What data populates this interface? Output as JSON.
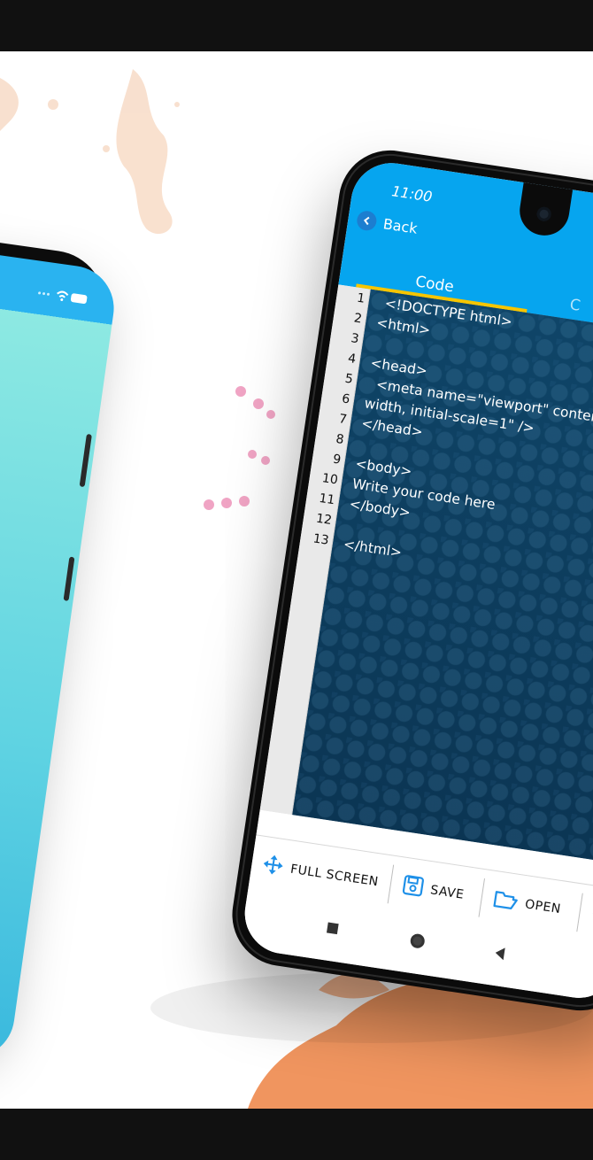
{
  "status": {
    "time": "11:00"
  },
  "header": {
    "back_label": "Back"
  },
  "tabs": [
    {
      "label": "Code",
      "active": true
    },
    {
      "label": "C",
      "active": false
    }
  ],
  "editor": {
    "line_numbers": [
      "1",
      "2",
      "3",
      "4",
      "5",
      "6",
      "7",
      "8",
      "9",
      "10",
      "11",
      "12",
      "13"
    ],
    "lines": [
      "<!DOCTYPE html>",
      "<html>",
      "",
      "<head>",
      "<meta name=\"viewport\" content=\"width=device-",
      "width, initial-scale=1\" />",
      "</head>",
      "",
      "<body>",
      "Write your code here",
      "</body>",
      "",
      "</html>"
    ]
  },
  "toolbar": {
    "fullscreen_label": "FULL SCREEN",
    "save_label": "SAVE",
    "open_label": "OPEN"
  },
  "colors": {
    "app_blue": "#06a5ef",
    "tab_indicator": "#f7c500",
    "editor_bg": "#0d3d5c",
    "icon_blue": "#1e90e8"
  }
}
